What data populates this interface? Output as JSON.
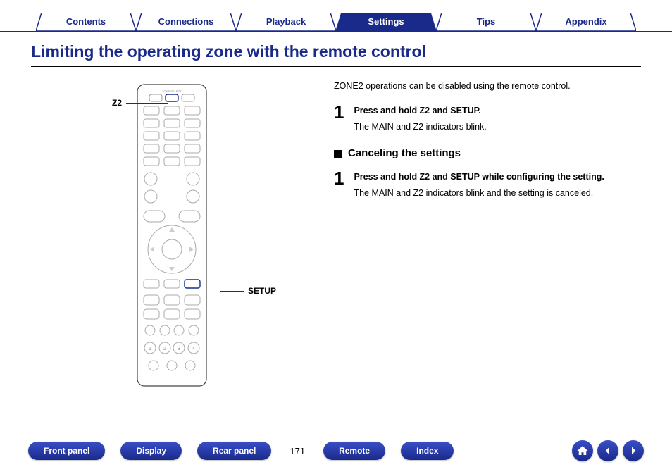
{
  "top_tabs": {
    "items": [
      {
        "label": "Contents",
        "active": false
      },
      {
        "label": "Connections",
        "active": false
      },
      {
        "label": "Playback",
        "active": false
      },
      {
        "label": "Settings",
        "active": true
      },
      {
        "label": "Tips",
        "active": false
      },
      {
        "label": "Appendix",
        "active": false
      }
    ]
  },
  "title": "Limiting the operating zone with the remote control",
  "callouts": {
    "z2": "Z2",
    "setup": "SETUP"
  },
  "intro": "ZONE2 operations can be disabled using the remote control.",
  "step1": {
    "num": "1",
    "title": "Press and hold Z2 and SETUP.",
    "body": "The MAIN and Z2 indicators blink."
  },
  "subhead": "Canceling the settings",
  "step2": {
    "num": "1",
    "title": "Press and hold Z2 and SETUP while configuring the setting.",
    "body": "The MAIN and Z2 indicators blink and the setting is canceled."
  },
  "bottom": {
    "buttons": [
      "Front panel",
      "Display",
      "Rear panel",
      "Remote",
      "Index"
    ],
    "page": "171"
  }
}
